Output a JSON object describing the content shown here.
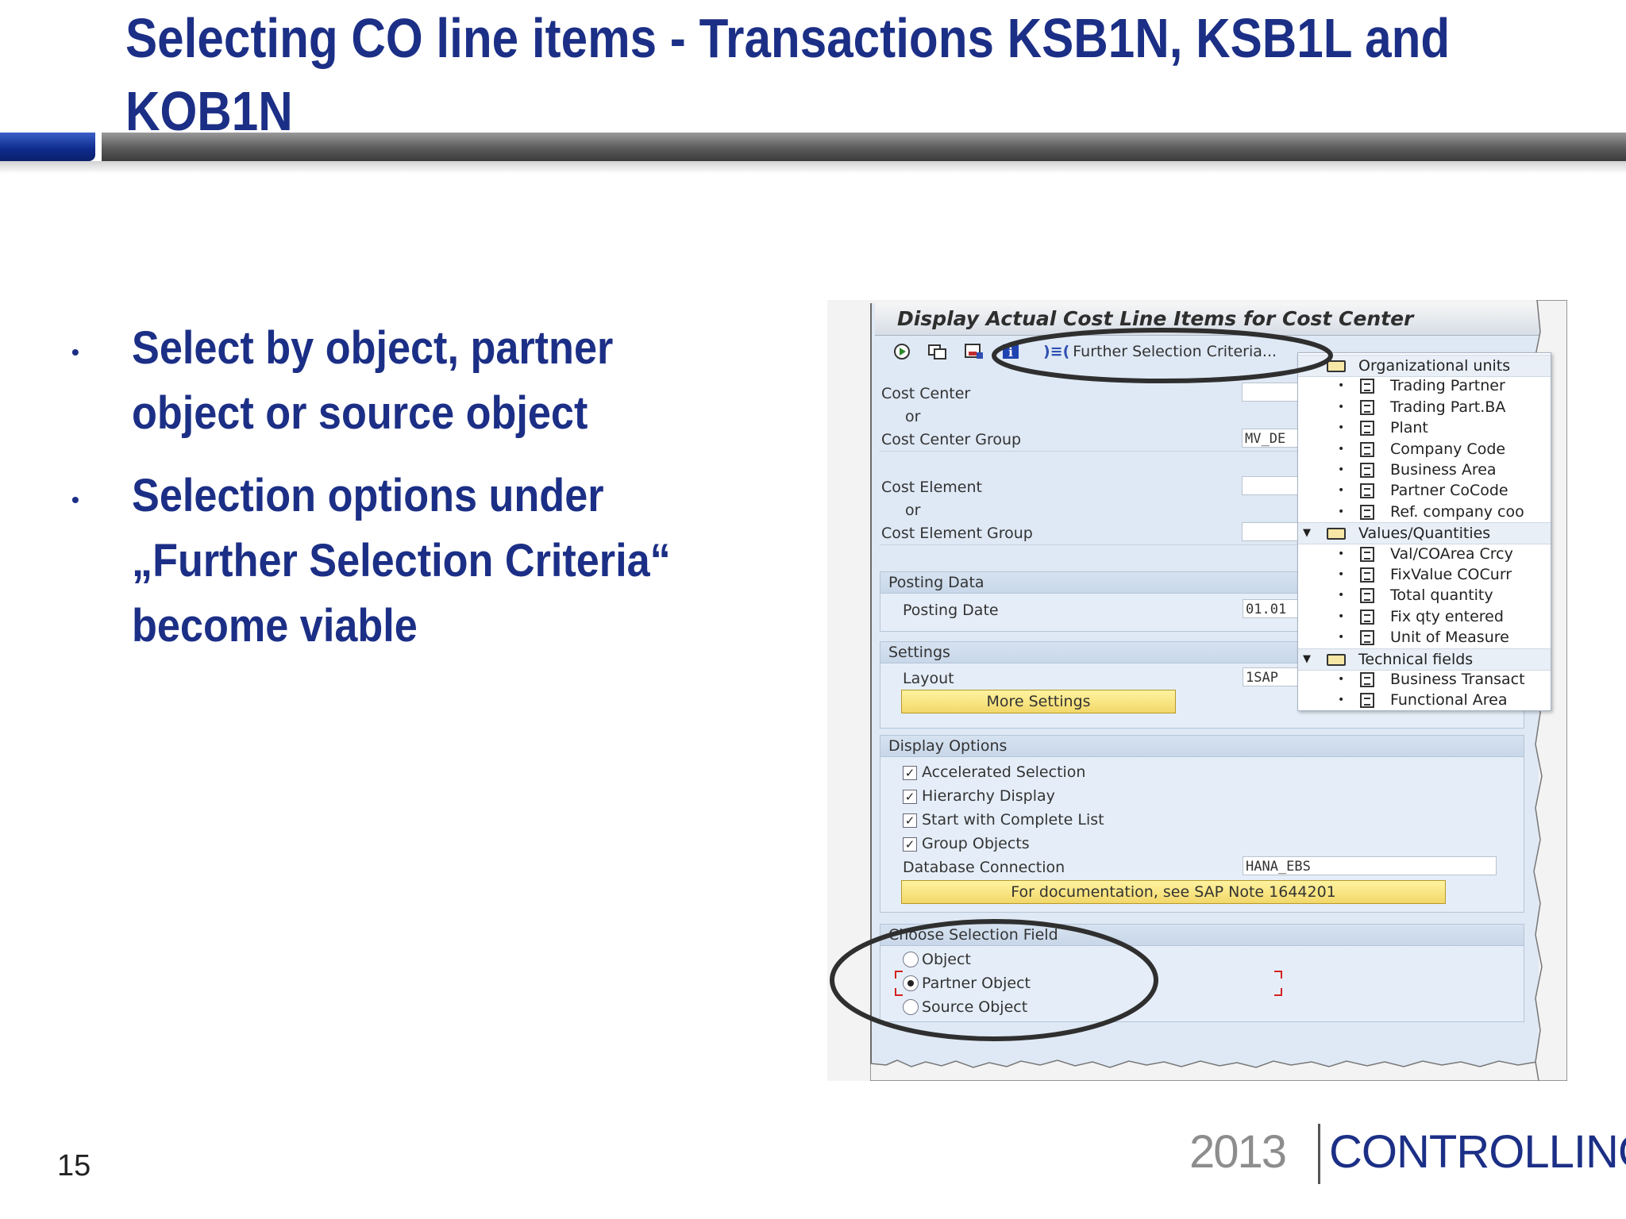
{
  "slide": {
    "title": "Selecting CO line items - Transactions KSB1N, KSB1L and KOB1N",
    "bullets": [
      "Select by object, partner\nobject or source object",
      "Selection options under\n„Further Selection Criteria“\nbecome viable"
    ],
    "bullet_symbol": "•",
    "page_number": "15",
    "logo": {
      "year": "2013",
      "word": "CONTROLLING"
    }
  },
  "sap": {
    "window_title": "Display Actual Cost Line Items for Cost Center",
    "toolbar": {
      "icons": [
        "execute-icon",
        "get-variant-icon",
        "save-variant-icon",
        "info-icon"
      ],
      "further_selection_label": "Further Selection Criteria..."
    },
    "fields": {
      "cost_center_label": "Cost Center",
      "or_1": "or",
      "cost_center_group_label": "Cost Center Group",
      "cost_center_group_value": "MV_DE",
      "cost_element_label": "Cost Element",
      "or_2": "or",
      "cost_element_group_label": "Cost Element Group"
    },
    "posting_data": {
      "header": "Posting Data",
      "posting_date_label": "Posting Date",
      "posting_date_value": "01.01"
    },
    "settings": {
      "header": "Settings",
      "layout_label": "Layout",
      "layout_value": "1SAP",
      "more_settings_button": "More Settings"
    },
    "display_options": {
      "header": "Display Options",
      "checkboxes": [
        {
          "label": "Accelerated Selection",
          "checked": true
        },
        {
          "label": "Hierarchy Display",
          "checked": true
        },
        {
          "label": "Start with Complete List",
          "checked": true
        },
        {
          "label": "Group Objects",
          "checked": true
        }
      ],
      "db_connection_label": "Database Connection",
      "db_connection_value": "HANA_EBS",
      "note_button": "For documentation, see SAP Note 1644201"
    },
    "choose_selection_field": {
      "header": "Choose Selection Field",
      "options": [
        {
          "label": "Object",
          "selected": false
        },
        {
          "label": "Partner Object",
          "selected": true
        },
        {
          "label": "Source Object",
          "selected": false
        }
      ]
    },
    "tree": [
      {
        "type": "folder",
        "label": "Organizational units",
        "expanded": false
      },
      {
        "type": "item",
        "label": "Trading Partner"
      },
      {
        "type": "item",
        "label": "Trading Part.BA"
      },
      {
        "type": "item",
        "label": "Plant"
      },
      {
        "type": "item",
        "label": "Company Code"
      },
      {
        "type": "item",
        "label": "Business Area"
      },
      {
        "type": "item",
        "label": "Partner CoCode"
      },
      {
        "type": "item",
        "label": "Ref. company coo"
      },
      {
        "type": "folder",
        "label": "Values/Quantities",
        "expanded": true
      },
      {
        "type": "item",
        "label": "Val/COArea Crcy"
      },
      {
        "type": "item",
        "label": "FixValue COCurr"
      },
      {
        "type": "item",
        "label": "Total quantity"
      },
      {
        "type": "item",
        "label": "Fix qty entered"
      },
      {
        "type": "item",
        "label": "Unit of Measure"
      },
      {
        "type": "folder",
        "label": "Technical fields",
        "expanded": true
      },
      {
        "type": "item",
        "label": "Business Transact"
      },
      {
        "type": "item",
        "label": "Functional Area"
      }
    ]
  },
  "colors": {
    "title_blue": "#1c2f86",
    "callout_stroke": "#2f2f2f",
    "sap_background": "#dfe9f5",
    "button_yellow": "#f2d86a"
  }
}
